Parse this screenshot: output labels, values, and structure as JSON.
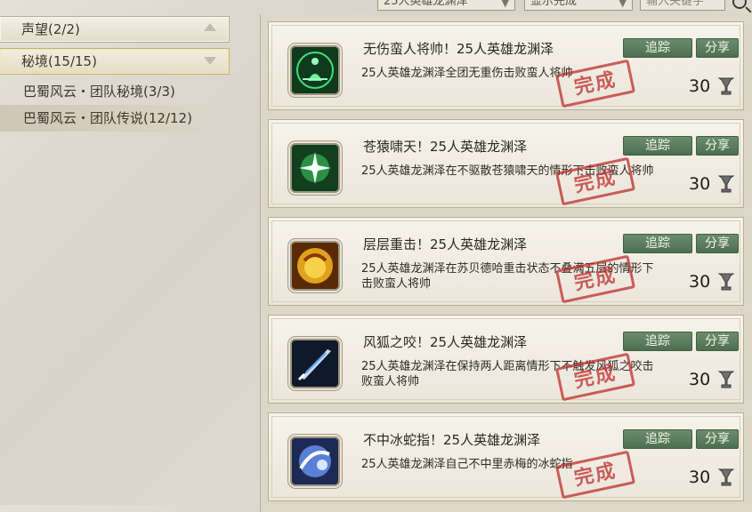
{
  "filters": {
    "raid_select": "25人英雄龙渊泽",
    "status_select": "显示完成",
    "search_placeholder": "输入关键字"
  },
  "nav": {
    "categories": [
      {
        "label": "声望(2/2)",
        "state": "collapsed"
      },
      {
        "label": "秘境(15/15)",
        "state": "expanded"
      }
    ],
    "subitems": [
      {
        "label": "巴蜀风云・团队秘境(3/3)",
        "active": false
      },
      {
        "label": "巴蜀风云・团队传说(12/12)",
        "active": true
      }
    ]
  },
  "achievements": [
    {
      "title": "无伤蛮人将帅！25人英雄龙渊泽",
      "desc": "25人英雄龙渊泽全团无重伤击败蛮人将帅",
      "track": "追踪",
      "share": "分享",
      "points": "30",
      "stamp": "完成",
      "icon": "meditating-figure-icon"
    },
    {
      "title": "苍猿啸天！25人英雄龙渊泽",
      "desc": "25人英雄龙渊泽在不驱散苍猿啸天的情形下击败蛮人将帅",
      "track": "追踪",
      "share": "分享",
      "points": "30",
      "stamp": "完成",
      "icon": "burst-star-icon"
    },
    {
      "title": "层层重击！25人英雄龙渊泽",
      "desc": "25人英雄龙渊泽在苏贝德哈重击状态不叠满五层的情形下击败蛮人将帅",
      "track": "追踪",
      "share": "分享",
      "points": "30",
      "stamp": "完成",
      "icon": "fist-strike-icon"
    },
    {
      "title": "风狐之咬！25人英雄龙渊泽",
      "desc": "25人英雄龙渊泽在保持两人距离情形下不触发风狐之咬击败蛮人将帅",
      "track": "追踪",
      "share": "分享",
      "points": "30",
      "stamp": "完成",
      "icon": "blade-icon"
    },
    {
      "title": "不中冰蛇指！25人英雄龙渊泽",
      "desc": "25人英雄龙渊泽自己不中里赤梅的冰蛇指",
      "track": "追踪",
      "share": "分享",
      "points": "30",
      "stamp": "完成",
      "icon": "ice-finger-icon"
    }
  ],
  "colors": {
    "button_green": "#55775a",
    "stamp_red": "#be2c2c",
    "panel_bg": "#ddd7c9"
  }
}
